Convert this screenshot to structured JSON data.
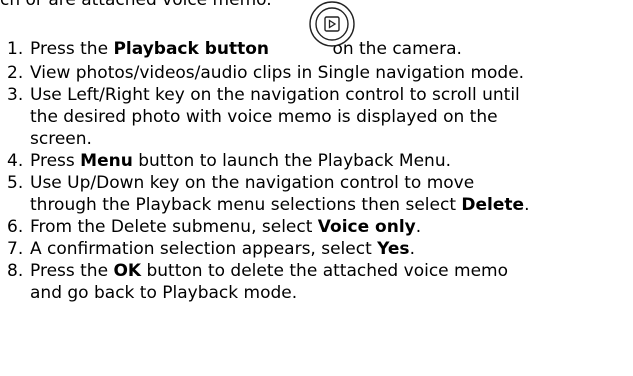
{
  "top_fragment": "ch or are attached voice memo.",
  "steps": [
    {
      "num": "1.",
      "pre": "Press the ",
      "bold": "Playback button",
      "post": "on the camera."
    },
    {
      "num": "2.",
      "text": "View photos/videos/audio clips in Single navigation mode."
    },
    {
      "num": "3.",
      "line1": "Use Left/Right key on the navigation control to scroll until",
      "line2": "the desired photo with voice memo is displayed on the",
      "line3": "screen."
    },
    {
      "num": "4.",
      "pre": "Press ",
      "bold": "Menu",
      "post": " button to launch the Playback Menu."
    },
    {
      "num": "5.",
      "line1": "Use Up/Down key on the navigation control to move",
      "line2_pre": "through the Playback menu selections then select ",
      "line2_bold": "Delete",
      "line2_post": "."
    },
    {
      "num": "6.",
      "pre": "From the Delete submenu, select ",
      "bold": "Voice only",
      "post": "."
    },
    {
      "num": "7.",
      "pre": "A confirmation selection appears, select ",
      "bold": "Yes",
      "post": "."
    },
    {
      "num": "8.",
      "pre": "Press the ",
      "bold": "OK",
      "post": " button to delete the attached voice memo",
      "line2": "and go back to Playback mode."
    }
  ],
  "icons": {
    "playback": "playback-button-icon"
  }
}
